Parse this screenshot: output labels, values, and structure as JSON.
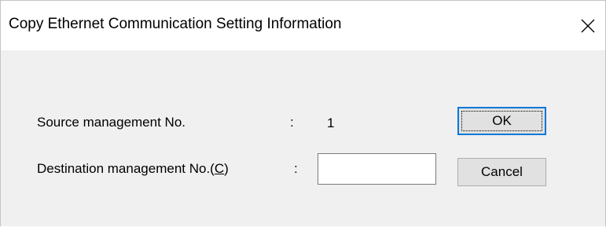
{
  "window": {
    "title": "Copy Ethernet Communication Setting Information",
    "close_glyph": "✕"
  },
  "form": {
    "source_label": "Source management No.",
    "source_colon": ":",
    "source_value": "1",
    "dest_label_prefix": "Destination management No.(",
    "dest_label_accel": "C",
    "dest_label_suffix": ")",
    "dest_colon": ":",
    "dest_value": ""
  },
  "buttons": {
    "ok_label": "OK",
    "cancel_label": "Cancel"
  }
}
